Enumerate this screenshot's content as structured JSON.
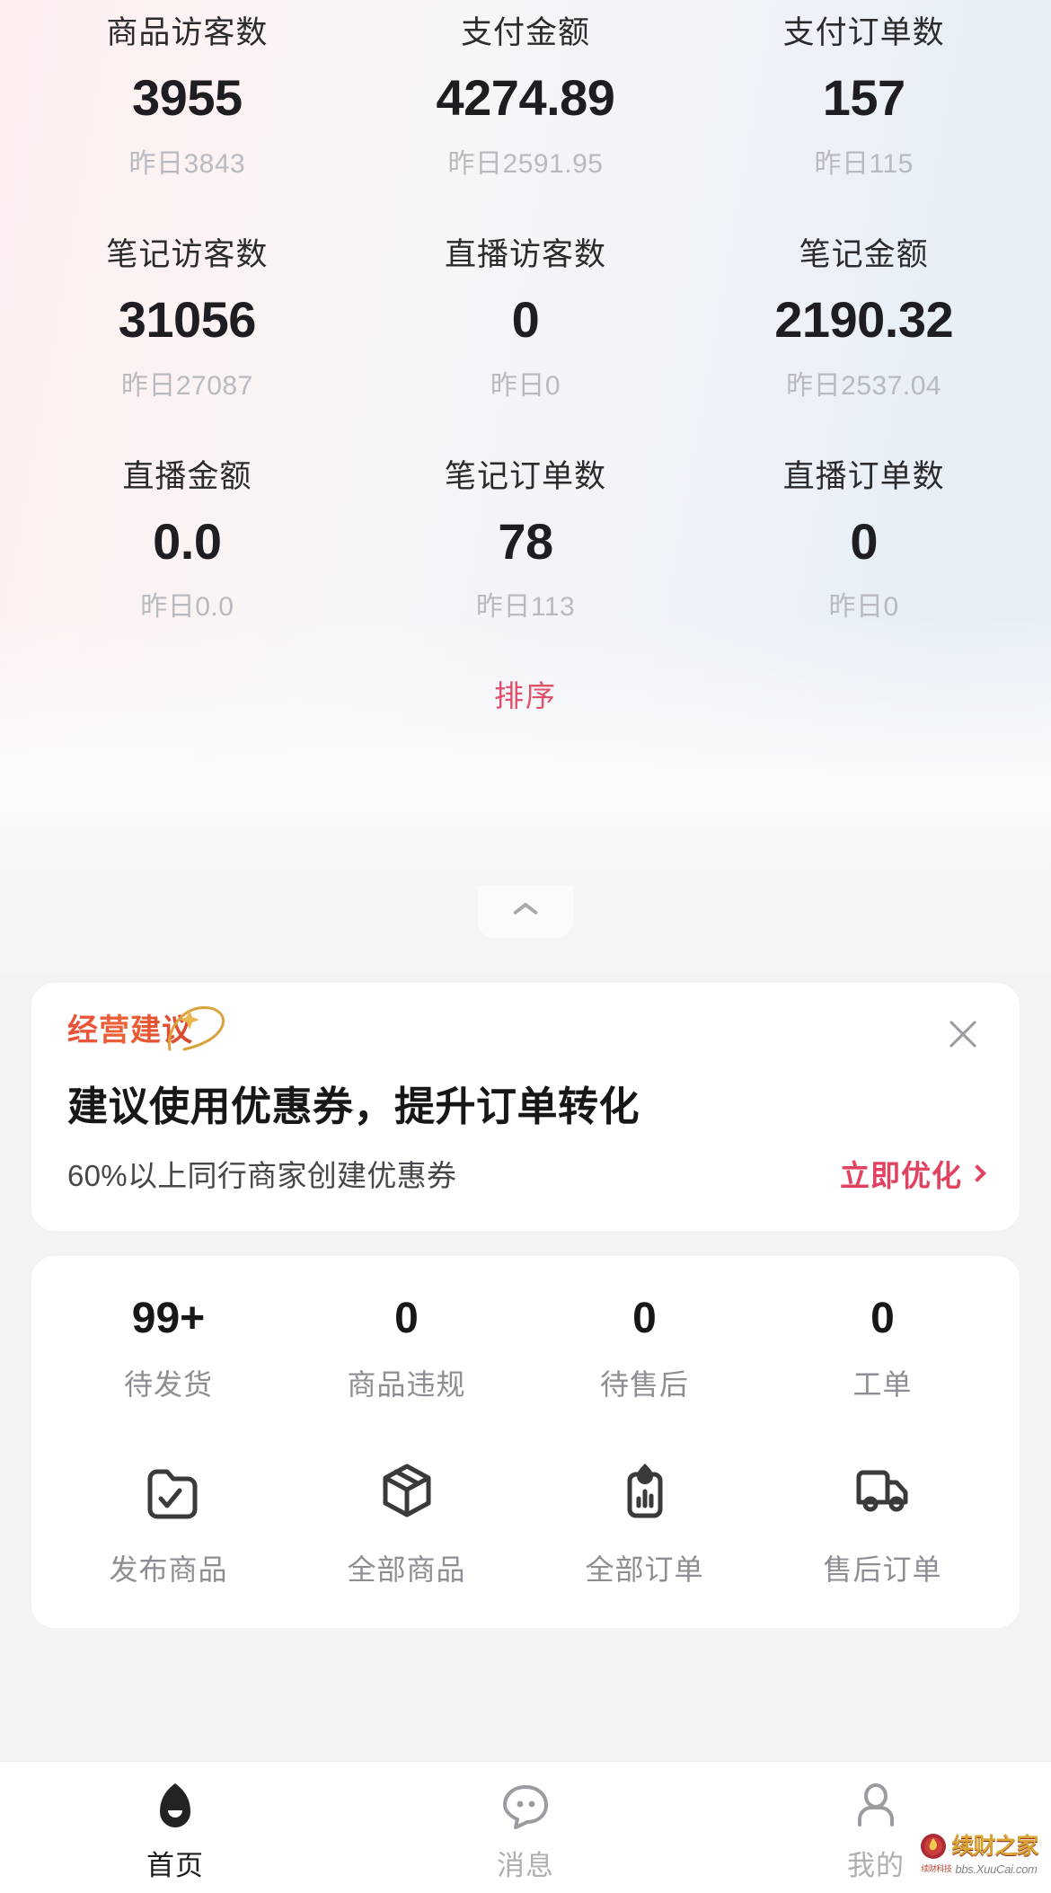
{
  "metrics": [
    {
      "label": "商品访客数",
      "value": "3955",
      "yesterday": "昨日3843"
    },
    {
      "label": "支付金额",
      "value": "4274.89",
      "yesterday": "昨日2591.95"
    },
    {
      "label": "支付订单数",
      "value": "157",
      "yesterday": "昨日115"
    },
    {
      "label": "笔记访客数",
      "value": "31056",
      "yesterday": "昨日27087"
    },
    {
      "label": "直播访客数",
      "value": "0",
      "yesterday": "昨日0"
    },
    {
      "label": "笔记金额",
      "value": "2190.32",
      "yesterday": "昨日2537.04"
    },
    {
      "label": "直播金额",
      "value": "0.0",
      "yesterday": "昨日0.0"
    },
    {
      "label": "笔记订单数",
      "value": "78",
      "yesterday": "昨日113"
    },
    {
      "label": "直播订单数",
      "value": "0",
      "yesterday": "昨日0"
    }
  ],
  "sort": {
    "label": "排序",
    "color": "#e3506b"
  },
  "collapse": {
    "icon": "chevron-up-icon"
  },
  "suggestion": {
    "badge": "经营建议",
    "title": "建议使用优惠券，提升订单转化",
    "desc": "60%以上同行商家创建优惠券",
    "cta": "立即优化",
    "cta_color": "#e0425f",
    "close_icon": "close-icon"
  },
  "counts": [
    {
      "value": "99+",
      "label": "待发货"
    },
    {
      "value": "0",
      "label": "商品违规"
    },
    {
      "value": "0",
      "label": "待售后"
    },
    {
      "value": "0",
      "label": "工单"
    }
  ],
  "shortcuts": [
    {
      "label": "发布商品",
      "icon": "folder-check-icon"
    },
    {
      "label": "全部商品",
      "icon": "box-icon"
    },
    {
      "label": "全部订单",
      "icon": "clipboard-chart-icon"
    },
    {
      "label": "售后订单",
      "icon": "truck-icon"
    }
  ],
  "tabbar": [
    {
      "label": "首页",
      "icon": "home-icon",
      "active": true
    },
    {
      "label": "消息",
      "icon": "message-icon",
      "active": false
    },
    {
      "label": "我的",
      "icon": "profile-icon",
      "active": false
    }
  ],
  "watermark": {
    "title": "续财之家",
    "url": "bbs.XuuCai.com",
    "sub": "续财科技"
  }
}
